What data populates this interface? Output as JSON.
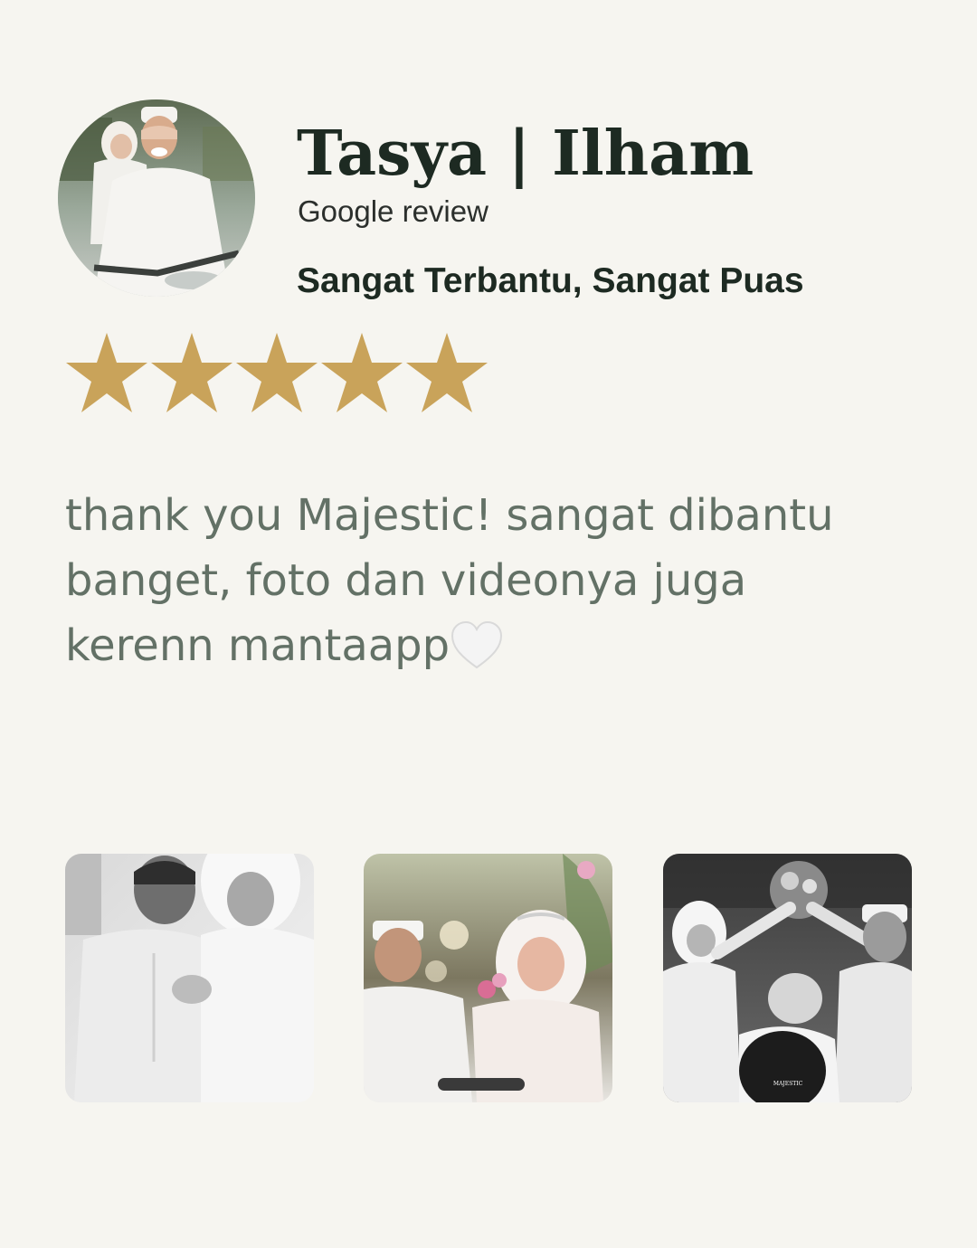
{
  "review": {
    "reviewer_name": "Tasya | Ilham",
    "source": "Google review",
    "headline": "Sangat Terbantu, Sangat Puas",
    "rating": 5,
    "rating_max": 5,
    "body": "thank you Majestic! sangat dibantu banget, foto dan videonya juga kerenn mantaapp",
    "body_emoji": "white-heart-icon"
  },
  "colors": {
    "background": "#f6f5f0",
    "name": "#1d2a22",
    "body_text": "#637166",
    "star": "#c9a35a"
  },
  "photos": [
    {
      "name": "couple-portrait-photo"
    },
    {
      "name": "bride-groom-ceremony-photo"
    },
    {
      "name": "bouquet-celebration-photo",
      "watermark": "MAJESTIC"
    }
  ]
}
